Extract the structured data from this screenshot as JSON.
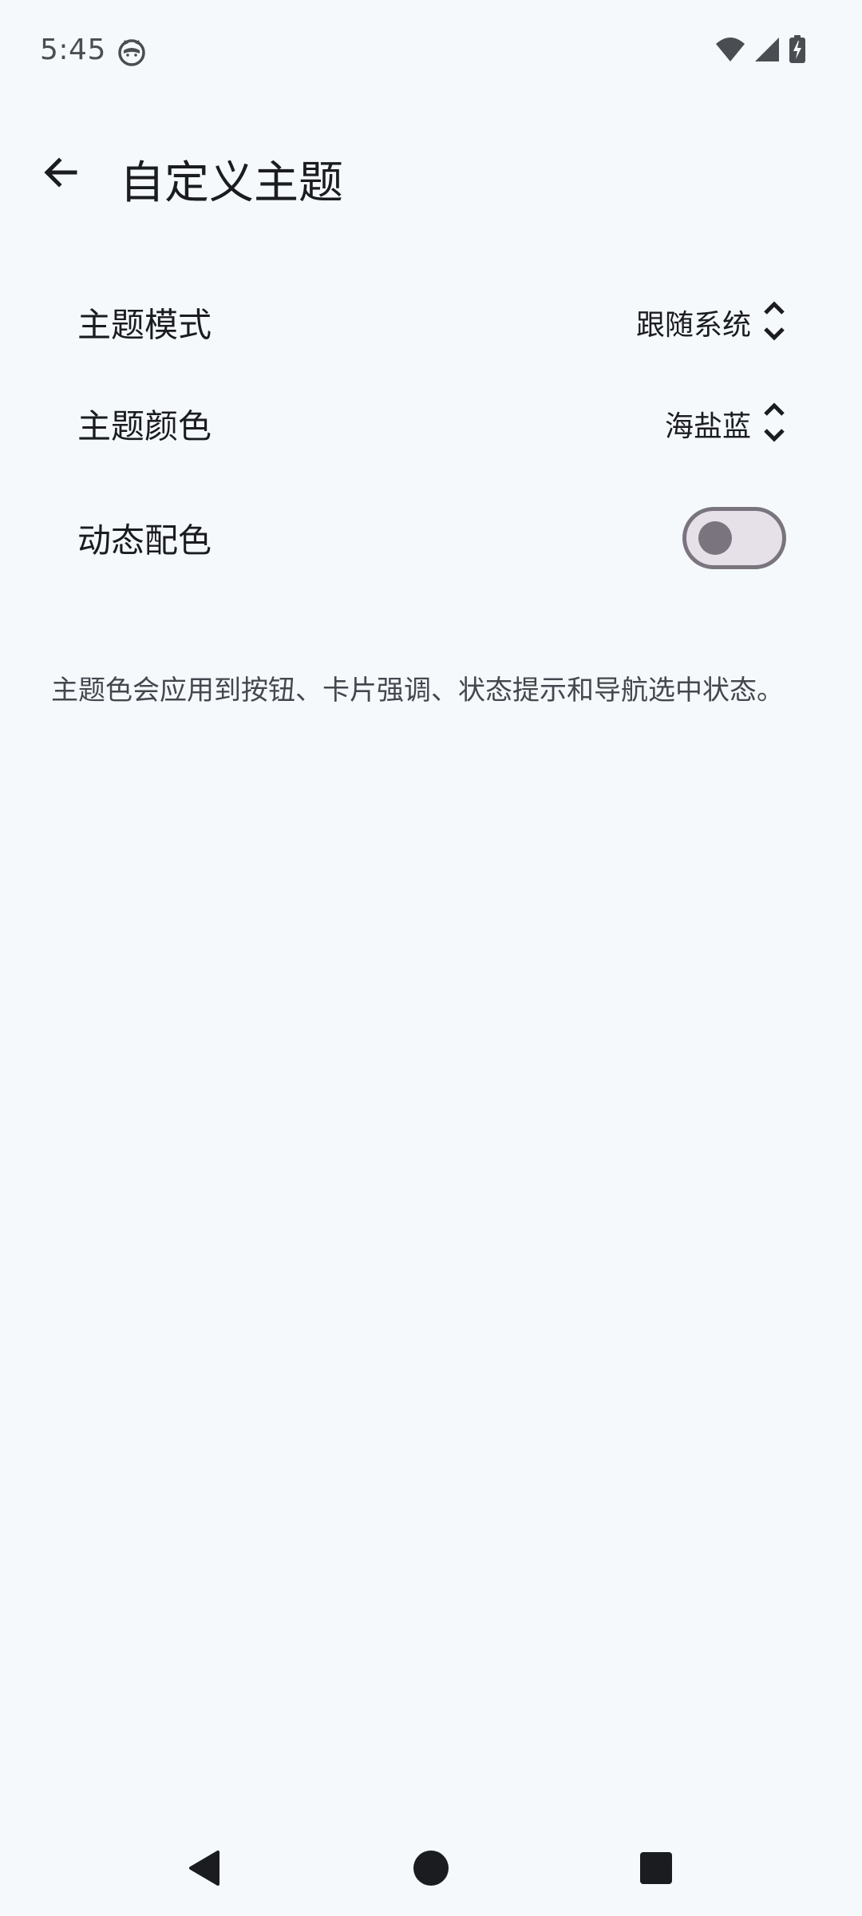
{
  "status_bar": {
    "time": "5:45",
    "app_icon": "cat-face-icon",
    "icons": [
      "wifi-icon",
      "cellular-signal-icon",
      "battery-charging-icon"
    ]
  },
  "header": {
    "back_icon": "back-arrow-icon",
    "title": "自定义主题"
  },
  "settings": {
    "theme_mode": {
      "label": "主题模式",
      "value": "跟随系统",
      "icon": "unfold-icon"
    },
    "theme_color": {
      "label": "主题颜色",
      "value": "海盐蓝",
      "icon": "unfold-icon"
    },
    "dynamic_color": {
      "label": "动态配色",
      "enabled": false
    }
  },
  "description": "主题色会应用到按钮、卡片强调、状态提示和导航选中状态。",
  "nav_bar": {
    "icons": [
      "nav-back-icon",
      "nav-home-icon",
      "nav-recents-icon"
    ]
  },
  "colors": {
    "background": "#f5f9fc",
    "text_primary": "#1b1c1f",
    "text_secondary": "#44474e",
    "switch_outline": "#79747e",
    "switch_track": "#e6e0e9"
  }
}
